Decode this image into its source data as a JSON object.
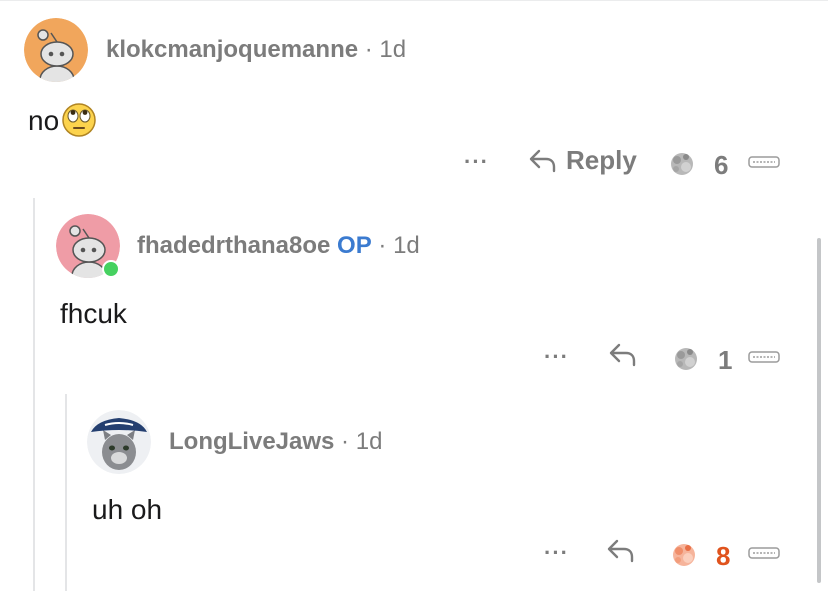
{
  "comments": [
    {
      "username": "klokcmanjoquemanne",
      "op_badge": "",
      "separator": "·",
      "time": "1d",
      "text": "no",
      "emoji": "face-with-rolling-eyes-icon",
      "more": "···",
      "reply_label": "Reply",
      "award_count": "6",
      "avatar_color": "#f1a65c"
    },
    {
      "username": "fhadedrthana8oe",
      "op_badge": "OP",
      "separator": "·",
      "time": "1d",
      "text": "fhcuk",
      "more": "···",
      "award_count": "1",
      "avatar_color": "#ef9ca6",
      "online": true
    },
    {
      "username": "LongLiveJaws",
      "op_badge": "",
      "separator": "·",
      "time": "1d",
      "text": "uh oh",
      "more": "···",
      "award_count": "8",
      "award_active": true,
      "count_color": "#e0531d"
    }
  ]
}
